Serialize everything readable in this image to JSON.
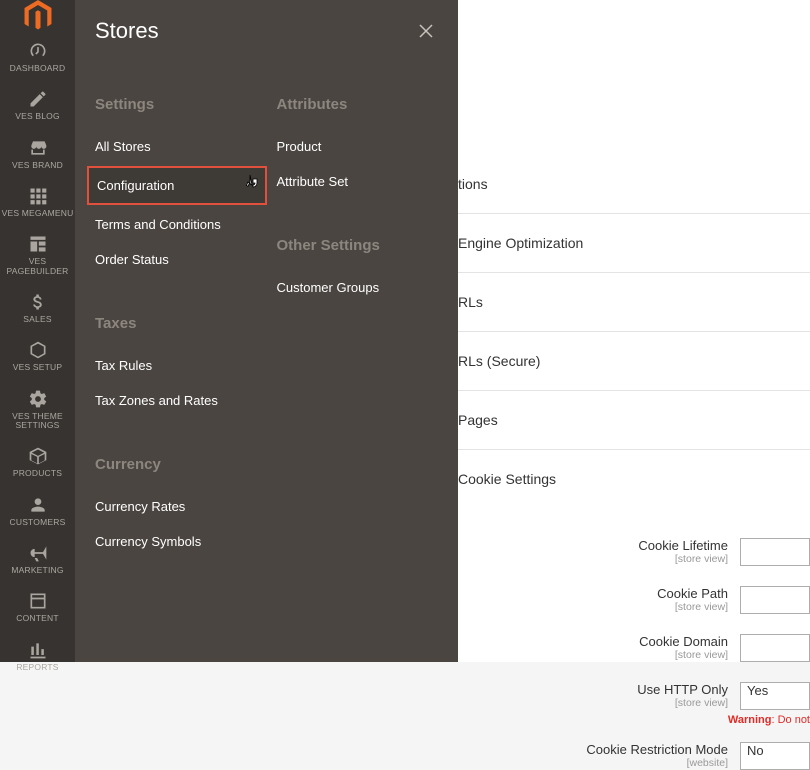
{
  "rail": {
    "items": [
      {
        "label": "DASHBOARD"
      },
      {
        "label": "VES BLOG"
      },
      {
        "label": "VES BRAND"
      },
      {
        "label": "VES MEGAMENU"
      },
      {
        "label": "VES PAGEBUILDER"
      },
      {
        "label": "SALES"
      },
      {
        "label": "VES SETUP"
      },
      {
        "label": "VES THEME SETTINGS"
      },
      {
        "label": "PRODUCTS"
      },
      {
        "label": "CUSTOMERS"
      },
      {
        "label": "MARKETING"
      },
      {
        "label": "CONTENT"
      },
      {
        "label": "REPORTS"
      }
    ]
  },
  "flyout": {
    "title": "Stores",
    "col1": {
      "settings_heading": "Settings",
      "settings": [
        {
          "label": "All Stores"
        },
        {
          "label": "Configuration"
        },
        {
          "label": "Terms and Conditions"
        },
        {
          "label": "Order Status"
        }
      ],
      "taxes_heading": "Taxes",
      "taxes": [
        {
          "label": "Tax Rules"
        },
        {
          "label": "Tax Zones and Rates"
        }
      ],
      "currency_heading": "Currency",
      "currency": [
        {
          "label": "Currency Rates"
        },
        {
          "label": "Currency Symbols"
        }
      ]
    },
    "col2": {
      "attributes_heading": "Attributes",
      "attributes": [
        {
          "label": "Product"
        },
        {
          "label": "Attribute Set"
        }
      ],
      "other_heading": "Other Settings",
      "other": [
        {
          "label": "Customer Groups"
        }
      ]
    }
  },
  "main": {
    "links": [
      {
        "label": "tions"
      },
      {
        "label": "Engine Optimization"
      },
      {
        "label": "RLs"
      },
      {
        "label": "RLs (Secure)"
      },
      {
        "label": "Pages"
      },
      {
        "label": "Cookie Settings"
      }
    ],
    "form": [
      {
        "label": "Cookie Lifetime",
        "scope": "[store view]",
        "type": "text",
        "value": ""
      },
      {
        "label": "Cookie Path",
        "scope": "[store view]",
        "type": "text",
        "value": ""
      },
      {
        "label": "Cookie Domain",
        "scope": "[store view]",
        "type": "text",
        "value": ""
      },
      {
        "label": "Use HTTP Only",
        "scope": "[store view]",
        "type": "select",
        "value": "Yes"
      },
      {
        "label": "Cookie Restriction Mode",
        "scope": "[website]",
        "type": "select",
        "value": "No"
      }
    ],
    "warning_prefix": "Warning",
    "warning_suffix": ": Do not"
  }
}
